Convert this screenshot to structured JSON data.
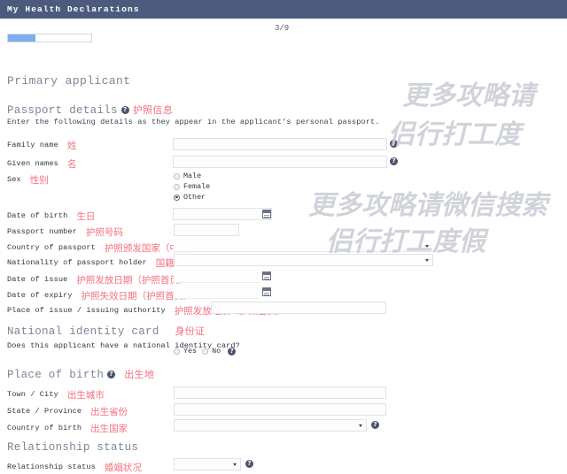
{
  "window": {
    "title": "My Health Declarations"
  },
  "progress": {
    "step_label": "3/9",
    "percent": 33,
    "fill_color": "#7daded"
  },
  "watermark": {
    "line1": "更多攻略请",
    "line2": "侣行打工度",
    "line3": "更多攻略请微信搜索",
    "line4": "侣行打工度假"
  },
  "sections": {
    "primary_applicant": {
      "title": "Primary applicant"
    },
    "passport_details": {
      "title": "Passport details",
      "title_cn": "护照信息",
      "intro": "Enter the following details as they appear in the applicant's personal passport.",
      "fields": {
        "family_name": {
          "label": "Family name",
          "label_cn": "姓",
          "value": ""
        },
        "given_names": {
          "label": "Given names",
          "label_cn": "名",
          "value": ""
        },
        "sex": {
          "label": "Sex",
          "label_cn": "性别",
          "options": [
            "Male",
            "Female",
            "Other"
          ],
          "selected": "Other"
        },
        "date_of_birth": {
          "label": "Date of birth",
          "label_cn": "生日",
          "value": ""
        },
        "passport_number": {
          "label": "Passport number",
          "label_cn": "护照号码",
          "value": ""
        },
        "country_of_passport": {
          "label": "Country of passport",
          "label_cn": "护照颁发国家（中国）",
          "value": ""
        },
        "nationality": {
          "label": "Nationality of passport holder",
          "label_cn": "国籍",
          "value": ""
        },
        "date_of_issue": {
          "label": "Date of issue",
          "label_cn": "护照发放日期（护照首页）",
          "value": ""
        },
        "date_of_expiry": {
          "label": "Date of expiry",
          "label_cn": "护照失效日期（护照首页）",
          "value": ""
        },
        "place_of_issue": {
          "label": "Place of issue / issuing authority",
          "label_cn": "护照发放地点（护照首页）",
          "value": ""
        }
      }
    },
    "national_identity_card": {
      "title": "National identity card",
      "title_cn": "身份证",
      "question": "Does this applicant have a national identity card?",
      "options": [
        "Yes",
        "No"
      ],
      "selected": ""
    },
    "place_of_birth": {
      "title": "Place of birth",
      "title_cn": "出生地",
      "fields": {
        "town_city": {
          "label": "Town / City",
          "label_cn": "出生城市",
          "value": ""
        },
        "state_province": {
          "label": "State / Province",
          "label_cn": "出生省份",
          "value": ""
        },
        "country_of_birth": {
          "label": "Country of birth",
          "label_cn": "出生国家",
          "value": ""
        }
      }
    },
    "relationship_status": {
      "title": "Relationship status",
      "fields": {
        "relationship_status": {
          "label": "Relationship status",
          "label_cn": "婚姻状况",
          "value": ""
        }
      }
    }
  },
  "icons": {
    "help": "?"
  }
}
